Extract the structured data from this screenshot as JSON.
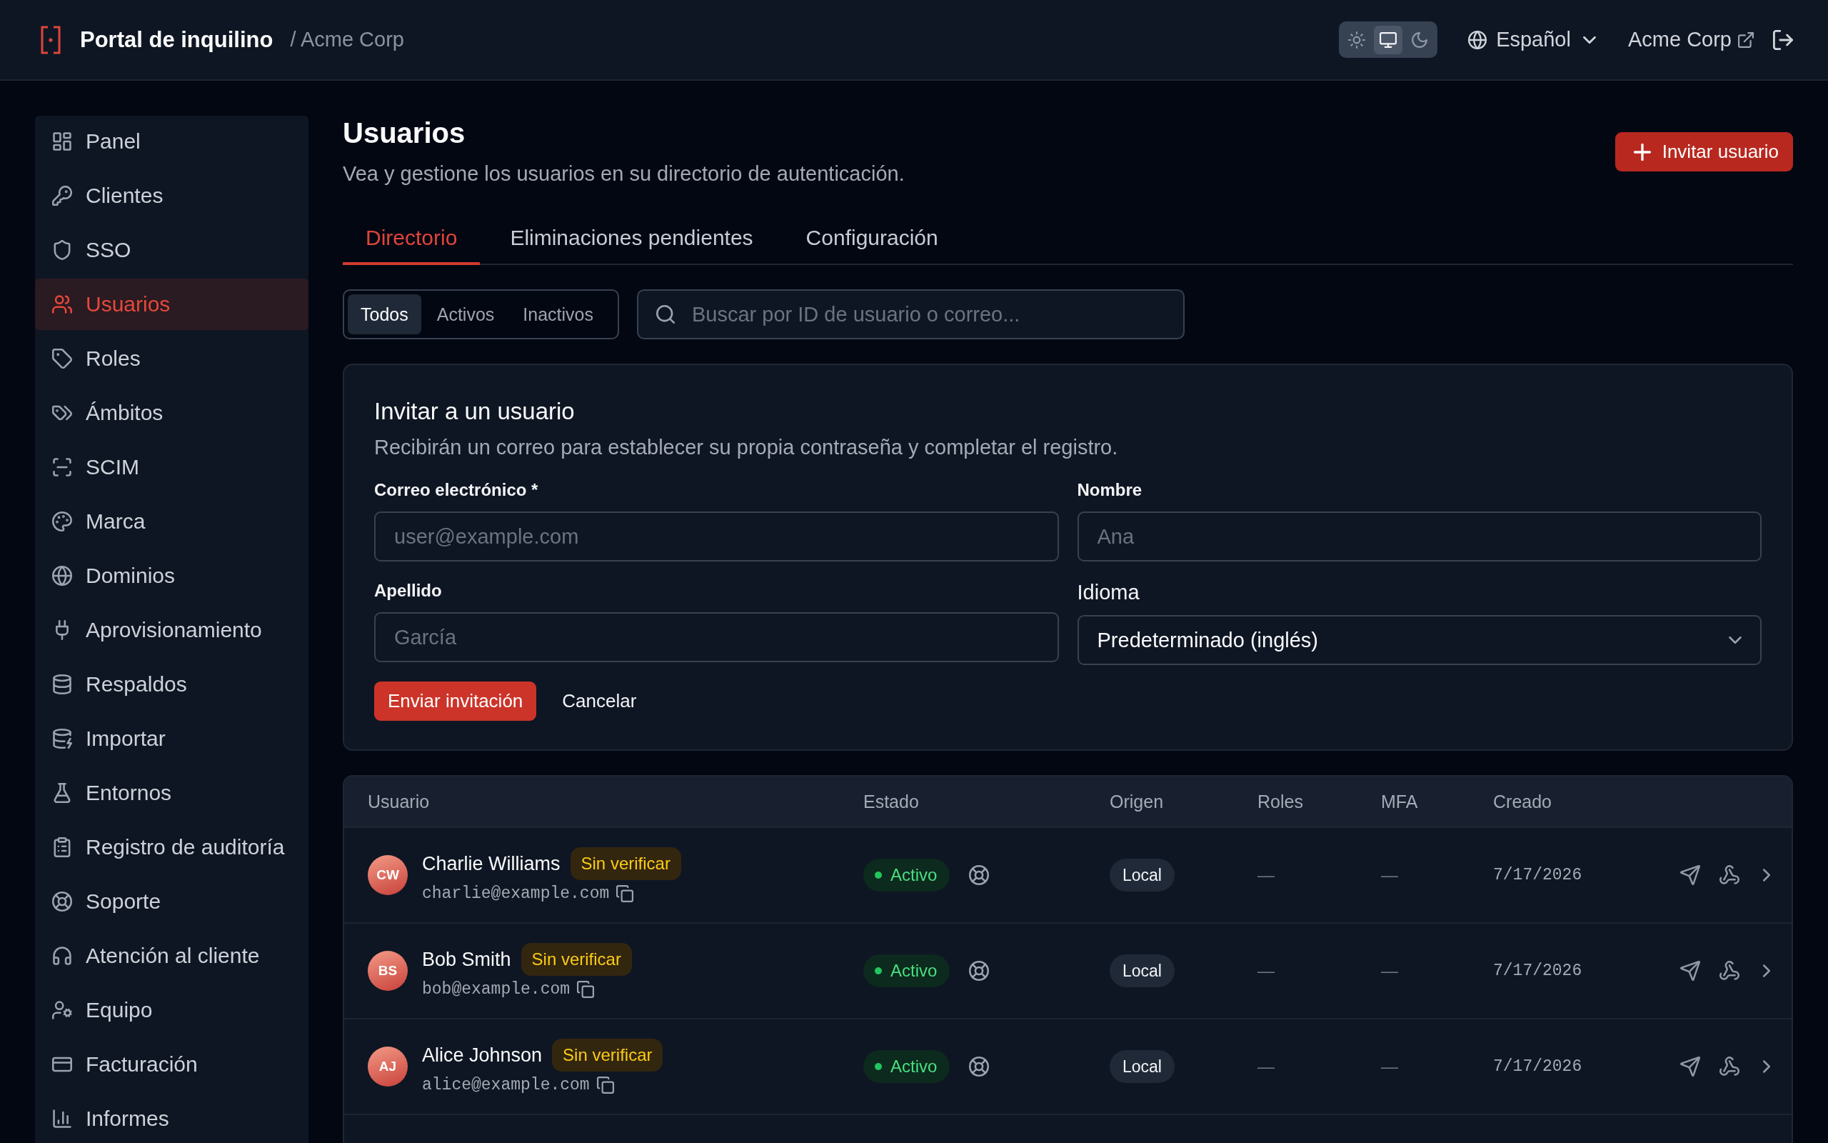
{
  "header": {
    "title": "Portal de inquilino",
    "breadcrumb": "/ Acme Corp",
    "theme_options": [
      {
        "selected": false
      },
      {
        "selected": true
      },
      {
        "selected": false
      }
    ],
    "language": "Español",
    "tenant": "Acme Corp"
  },
  "sidebar": {
    "items": [
      {
        "label": "Panel",
        "selected": false
      },
      {
        "label": "Clientes",
        "selected": false
      },
      {
        "label": "SSO",
        "selected": false
      },
      {
        "label": "Usuarios",
        "selected": true
      },
      {
        "label": "Roles",
        "selected": false
      },
      {
        "label": "Ámbitos",
        "selected": false
      },
      {
        "label": "SCIM",
        "selected": false
      },
      {
        "label": "Marca",
        "selected": false
      },
      {
        "label": "Dominios",
        "selected": false
      },
      {
        "label": "Aprovisionamiento",
        "selected": false
      },
      {
        "label": "Respaldos",
        "selected": false
      },
      {
        "label": "Importar",
        "selected": false
      },
      {
        "label": "Entornos",
        "selected": false
      },
      {
        "label": "Registro de auditoría",
        "selected": false
      },
      {
        "label": "Soporte",
        "selected": false
      },
      {
        "label": "Atención al cliente",
        "selected": false
      },
      {
        "label": "Equipo",
        "selected": false
      },
      {
        "label": "Facturación",
        "selected": false
      },
      {
        "label": "Informes",
        "selected": false
      }
    ]
  },
  "page": {
    "title": "Usuarios",
    "subtitle": "Vea y gestione los usuarios en su directorio de autenticación.",
    "invite_button": "Invitar usuario"
  },
  "tabs": [
    {
      "label": "Directorio",
      "selected": true
    },
    {
      "label": "Eliminaciones pendientes",
      "selected": false
    },
    {
      "label": "Configuración",
      "selected": false
    }
  ],
  "filters": [
    {
      "label": "Todos",
      "selected": true
    },
    {
      "label": "Activos",
      "selected": false
    },
    {
      "label": "Inactivos",
      "selected": false
    }
  ],
  "search": {
    "placeholder": "Buscar por ID de usuario o correo..."
  },
  "invite_form": {
    "title": "Invitar a un usuario",
    "description": "Recibirán un correo para establecer su propia contraseña y completar el registro.",
    "fields": [
      {
        "kind": "text",
        "label": "Correo electrónico *",
        "placeholder": "user@example.com"
      },
      {
        "kind": "text",
        "label": "Nombre",
        "placeholder": "Ana"
      },
      {
        "kind": "text",
        "label": "Apellido",
        "placeholder": "García"
      },
      {
        "kind": "select",
        "label": "Idioma",
        "value": "Predeterminado (inglés)"
      }
    ],
    "submit": "Enviar invitación",
    "cancel": "Cancelar"
  },
  "table": {
    "columns": [
      "Usuario",
      "Estado",
      "Origen",
      "Roles",
      "MFA",
      "Creado"
    ],
    "rows": [
      {
        "initials": "CW",
        "name": "Charlie Williams",
        "badge": "Sin verificar",
        "email": "charlie@example.com",
        "status": "Activo",
        "origin": "Local",
        "roles": "—",
        "mfa": "—",
        "created": "7/17/2026"
      },
      {
        "initials": "BS",
        "name": "Bob Smith",
        "badge": "Sin verificar",
        "email": "bob@example.com",
        "status": "Activo",
        "origin": "Local",
        "roles": "—",
        "mfa": "—",
        "created": "7/17/2026"
      },
      {
        "initials": "AJ",
        "name": "Alice Johnson",
        "badge": "Sin verificar",
        "email": "alice@example.com",
        "status": "Activo",
        "origin": "Local",
        "roles": "—",
        "mfa": "—",
        "created": "7/17/2026"
      }
    ]
  }
}
